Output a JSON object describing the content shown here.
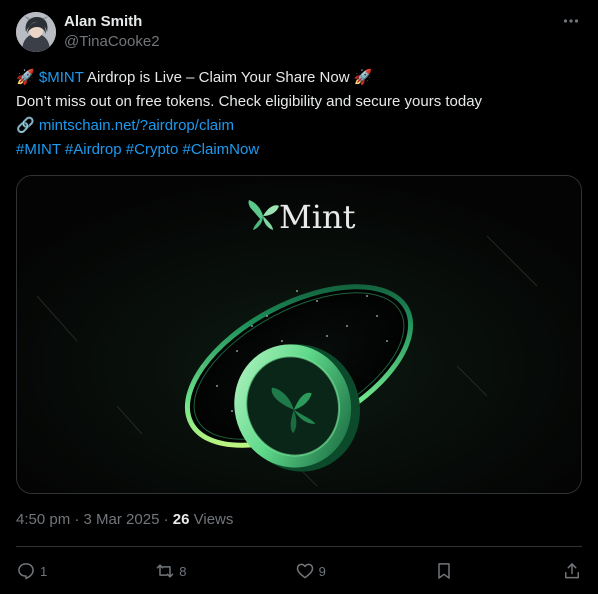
{
  "author": {
    "name": "Alan Smith",
    "handle": "@TinaCooke2"
  },
  "tweet": {
    "line1_emoji_start": "🚀",
    "line1_cashtag": "$MINT",
    "line1_text": " Airdrop is Live – Claim Your Share Now ",
    "line1_emoji_end": "🚀",
    "line2": "Don’t miss out on free tokens. Check eligibility and secure yours today",
    "link_emoji": "🔗",
    "link_text": "mintschain.net/?airdrop/claim",
    "hashtags": [
      "#MINT",
      "#Airdrop",
      "#Crypto",
      "#ClaimNow"
    ]
  },
  "media": {
    "brand_text": "Mint"
  },
  "meta": {
    "time": "4:50 pm",
    "date": "3 Mar 2025",
    "separator": "·",
    "views_count": "26",
    "views_label": "Views"
  },
  "actions": {
    "replies": "1",
    "reposts": "8",
    "likes": "9"
  },
  "icons": {
    "more": "more-horizontal-icon",
    "reply": "reply-icon",
    "repost": "repost-icon",
    "like": "heart-icon",
    "bookmark": "bookmark-icon",
    "share": "share-icon"
  },
  "colors": {
    "background": "#000000",
    "text": "#e7e9ea",
    "secondary": "#71767b",
    "link": "#1d9bf0",
    "border": "#2f3336",
    "mint_green": "#4cd07d"
  }
}
